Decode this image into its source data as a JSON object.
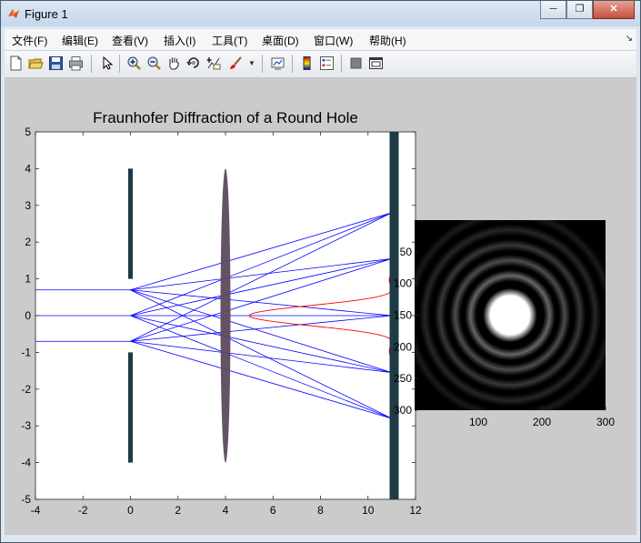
{
  "window": {
    "title": "Figure 1",
    "buttons": [
      "minimize",
      "restore",
      "close"
    ]
  },
  "menu": [
    "文件(F)",
    "编辑(E)",
    "查看(V)",
    "插入(I)",
    "工具(T)",
    "桌面(D)",
    "窗口(W)",
    "帮助(H)"
  ],
  "toolbar": {
    "icons": [
      "new-figure-icon",
      "open-file-icon",
      "save-icon",
      "print-icon",
      "edit-plot-arrow-icon",
      "zoom-in-icon",
      "zoom-out-icon",
      "pan-hand-icon",
      "rotate-3d-icon",
      "data-cursor-icon",
      "brush-icon",
      "brush-dropdown-icon",
      "link-plot-icon",
      "insert-colorbar-icon",
      "insert-legend-icon",
      "hide-plot-tools-icon",
      "show-plot-tools-icon"
    ]
  },
  "chart_data": [
    {
      "type": "line",
      "title": "Fraunhofer Diffraction of a Round Hole",
      "xlim": [
        -4,
        12
      ],
      "ylim": [
        -5,
        5
      ],
      "xticks": [
        "-4",
        "-2",
        "0",
        "2",
        "4",
        "6",
        "8",
        "10",
        "12"
      ],
      "yticks": [
        "-5",
        "-4",
        "-3",
        "-2",
        "-1",
        "0",
        "1",
        "2",
        "3",
        "4",
        "5"
      ],
      "grid": false,
      "aperture": {
        "x": 0,
        "y_blocks": [
          [
            1,
            4
          ],
          [
            -4,
            -1
          ]
        ],
        "color": "#1e3a44"
      },
      "lens": {
        "x": 4,
        "half_height": 4,
        "color": "#5c4a5e"
      },
      "screen": {
        "x": 11.1,
        "color": "#1e3a44"
      },
      "rays": {
        "color": "#0000ff",
        "source_y": [
          0.7,
          0,
          -0.7
        ],
        "start_x": -4,
        "split_x": 0,
        "lens_x": 4,
        "screen_x": 11,
        "hole_y": [
          0.7,
          0,
          -0.7
        ],
        "focus_y": [
          2.8,
          1.55,
          0,
          -1.55,
          -2.8
        ]
      },
      "intensity_profile": {
        "color": "#ff0000",
        "x_base": 11,
        "peak_height": 6,
        "center_y": 0,
        "first_zero_y": 0.72,
        "y_range": [
          -4,
          4
        ]
      }
    },
    {
      "type": "heatmap",
      "description_pattern": "airy-disk",
      "xlim": [
        0,
        300
      ],
      "ylim": [
        300,
        0
      ],
      "xticks": [
        "100",
        "200",
        "300"
      ],
      "yticks": [
        "50",
        "100",
        "150",
        "200",
        "250",
        "300"
      ],
      "center": [
        150,
        150
      ],
      "central_disk_radius": 34,
      "rings": [
        {
          "radius": 62,
          "brightness": 0.4
        },
        {
          "radius": 86,
          "brightness": 0.3
        },
        {
          "radius": 110,
          "brightness": 0.22
        },
        {
          "radius": 134,
          "brightness": 0.15
        },
        {
          "radius": 158,
          "brightness": 0.1
        }
      ],
      "colormap": "gray"
    }
  ]
}
